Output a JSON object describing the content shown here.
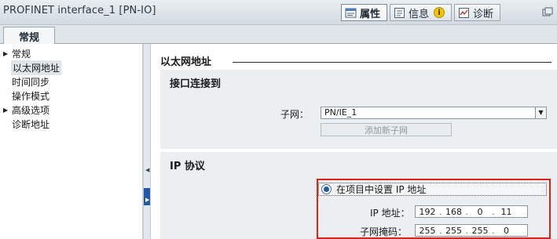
{
  "window": {
    "title": "PROFINET interface_1 [PN-IO]"
  },
  "property_tabs": [
    {
      "label": "属性",
      "icon": "properties-icon",
      "active": true
    },
    {
      "label": "信息",
      "icon": "info-list-icon",
      "badge": "i",
      "active": false
    },
    {
      "label": "诊断",
      "icon": "diagnostics-icon",
      "active": false
    }
  ],
  "general_tab": {
    "label": "常规"
  },
  "nav": {
    "items": [
      {
        "label": "常规",
        "has_arrow": true,
        "selected": false
      },
      {
        "label": "以太网地址",
        "has_arrow": false,
        "selected": true
      },
      {
        "label": "时间同步",
        "has_arrow": false,
        "selected": false
      },
      {
        "label": "操作模式",
        "has_arrow": false,
        "selected": false
      },
      {
        "label": "高级选项",
        "has_arrow": true,
        "selected": false
      },
      {
        "label": "诊断地址",
        "has_arrow": false,
        "selected": false
      }
    ]
  },
  "main": {
    "section_title": "以太网地址",
    "interface_group": {
      "title": "接口连接到",
      "subnet_label": "子网：",
      "subnet_value": "PN/IE_1",
      "add_subnet_button": "添加新子网"
    },
    "ip_group": {
      "title": "IP 协议",
      "radio_label": "在项目中设置 IP 地址",
      "radio_checked": true,
      "ip_label": "IP 地址：",
      "ip_octets": [
        "192",
        "168",
        "0",
        "11"
      ],
      "mask_label": "子网掩码：",
      "mask_octets": [
        "255",
        "255",
        "255",
        "0"
      ]
    }
  },
  "colors": {
    "highlight": "#e0211a",
    "accent": "#1e5aa8",
    "group_bg": "#eceff1"
  }
}
